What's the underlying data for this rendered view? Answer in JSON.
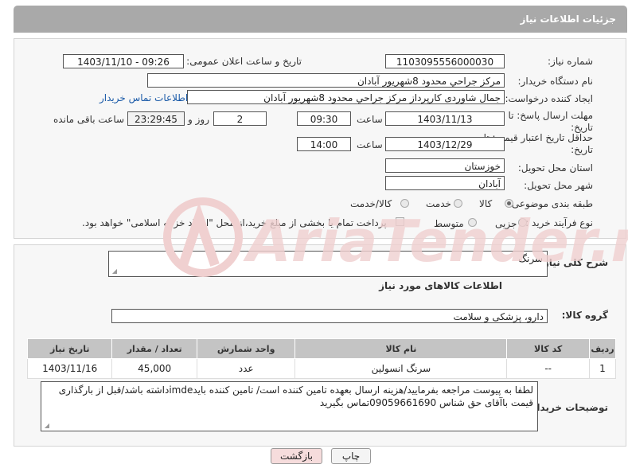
{
  "header": {
    "title": "جزئیات اطلاعات نیاز"
  },
  "fields": {
    "need_number_label": "شماره نیاز:",
    "need_number": "1103095556000030",
    "announce_label": "تاریخ و ساعت اعلان عمومی:",
    "announce_value": "1403/11/10 - 09:26",
    "buyer_label": "نام دستگاه خریدار:",
    "buyer_value": "مرکز جراحي محدود 8شهريور آبادان",
    "creator_label": "ایجاد کننده درخواست:",
    "creator_value": "جمال شاوردی کارپرداز مرکز جراحي محدود 8شهريور آبادان",
    "contact_link": "اطلاعات تماس خریدار",
    "deadline_label": "مهلت ارسال پاسخ: تا تاریخ:",
    "deadline_date": "1403/11/13",
    "time_label": "ساعت",
    "deadline_time": "09:30",
    "days": "2",
    "days_label": "روز و",
    "remaining": "23:29:45",
    "remaining_label": "ساعت باقی مانده",
    "validity_label": "حداقل تاریخ اعتبار قیمت: تا تاریخ:",
    "validity_date": "1403/12/29",
    "validity_time": "14:00",
    "province_label": "استان محل تحویل:",
    "province_value": "خوزستان",
    "city_label": "شهر محل تحویل:",
    "city_value": "آبادان",
    "category_label": "طبقه بندی موضوعی:",
    "category_options": [
      "کالا",
      "خدمت",
      "کالا/خدمت"
    ],
    "process_label": "نوع فرآیند خرید :",
    "process_options": [
      "جزیی",
      "متوسط"
    ],
    "payment_note": "پرداخت تمام یا بخشی از مبلغ خرید،از محل \"اسناد خزانه اسلامی\" خواهد بود."
  },
  "general": {
    "desc_label": "شرح کلی نیاز:",
    "desc_value": "سرنگ",
    "goods_info_label": "اطلاعات کالاهای مورد نیاز",
    "group_label": "گروه کالا:",
    "group_value": "دارو، پزشکی و سلامت"
  },
  "table": {
    "headers": [
      "ردیف",
      "کد کالا",
      "نام کالا",
      "واحد شمارش",
      "تعداد / مقدار",
      "تاریخ نیاز"
    ],
    "rows": [
      [
        "1",
        "--",
        "سرنگ انسولین",
        "عدد",
        "45,000",
        "1403/11/16"
      ]
    ]
  },
  "notes": {
    "label": "توضیحات خریدار:",
    "value": "لطفا به پیوست مراجعه بفرمایید/هزینه ارسال بعهده تامین کننده است/ تامین کننده بایدimdeداشته باشد/قبل از بارگذاری قیمت باآقای حق شناس 09059661690تماس بگیرید"
  },
  "buttons": {
    "print": "چاپ",
    "back": "بازگشت"
  },
  "watermark": {
    "text": "AriaTender.neT"
  },
  "colors": {
    "header_bg": "#a9a9a9",
    "link": "#1a5aa8",
    "back_button_bg": "#f6dcdc",
    "watermark": "#f0d0d0"
  }
}
